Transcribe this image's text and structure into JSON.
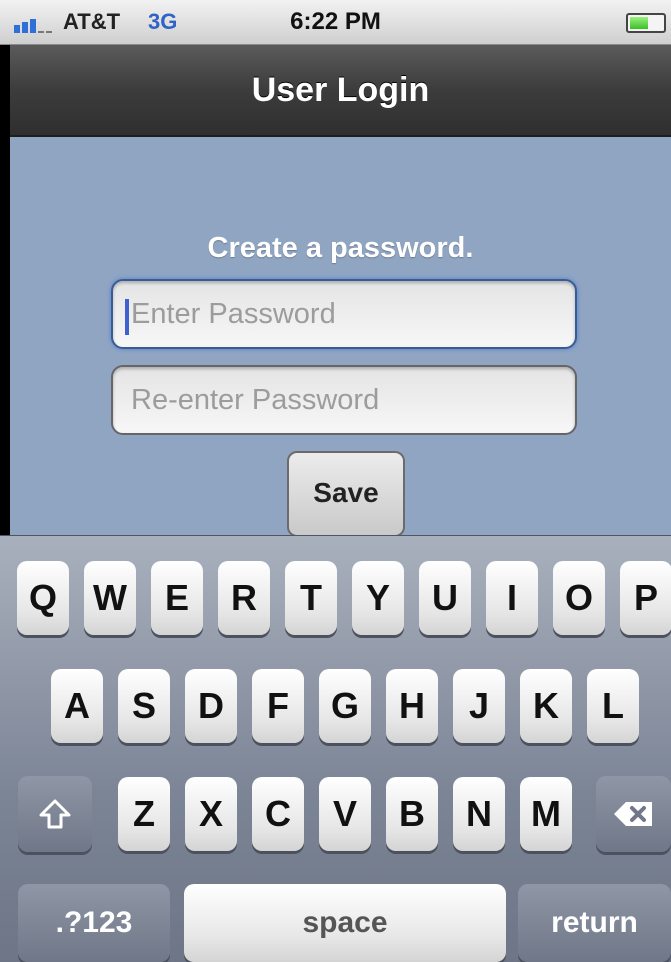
{
  "status_bar": {
    "carrier": "AT&T",
    "network": "3G",
    "time": "6:22 PM",
    "icons": [
      "signal-icon",
      "battery-icon"
    ],
    "battery_level": 0.55
  },
  "nav": {
    "title": "User Login"
  },
  "form": {
    "prompt": "Create a password.",
    "password_placeholder": "Enter Password",
    "password_value": "",
    "confirm_placeholder": "Re-enter Password",
    "confirm_value": "",
    "save_label": "Save"
  },
  "keyboard": {
    "row1": [
      "Q",
      "W",
      "E",
      "R",
      "T",
      "Y",
      "U",
      "I",
      "O",
      "P"
    ],
    "row2": [
      "A",
      "S",
      "D",
      "F",
      "G",
      "H",
      "J",
      "K",
      "L"
    ],
    "row3": [
      "Z",
      "X",
      "C",
      "V",
      "B",
      "N",
      "M"
    ],
    "shift_icon": "shift-icon",
    "delete_icon": "backspace-icon",
    "numbers_label": ".?123",
    "space_label": "space",
    "return_label": "return"
  },
  "colors": {
    "content_background": "#90a5c2",
    "navbar": "#3c3c3c",
    "accent": "#3f61cf"
  }
}
